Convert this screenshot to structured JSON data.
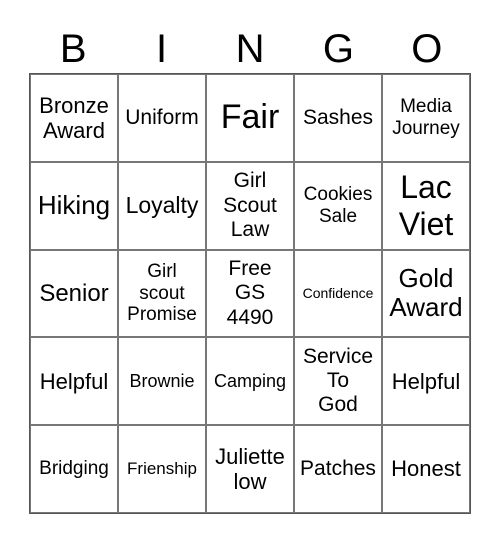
{
  "header": [
    "B",
    "I",
    "N",
    "G",
    "O"
  ],
  "cells": [
    [
      "Bronze\nAward",
      "Uniform",
      "Fair",
      "Sashes",
      "Media\nJourney"
    ],
    [
      "Hiking",
      "Loyalty",
      "Girl\nScout\nLaw",
      "Cookies\nSale",
      "Lac\nViet"
    ],
    [
      "Senior",
      "Girl\nscout\nPromise",
      "Free\nGS\n4490",
      "Confidence",
      "Gold\nAward"
    ],
    [
      "Helpful",
      "Brownie",
      "Camping",
      "Service\nTo\nGod",
      "Helpful"
    ],
    [
      "Bridging",
      "Frienship",
      "Juliette\nlow",
      "Patches",
      "Honest"
    ]
  ]
}
